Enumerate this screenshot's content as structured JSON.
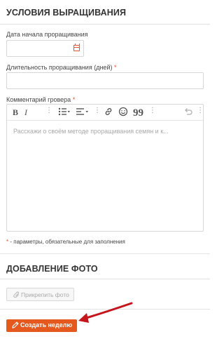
{
  "growing_conditions": {
    "title": "УСЛОВИЯ ВЫРАЩИВАНИЯ",
    "start_date_label": "Дата начала проращивания",
    "start_date_value": "",
    "duration_label": "Длительность проращивания (дней)",
    "duration_value": "",
    "required_mark": "*",
    "comment_label": "Комментарий гровера",
    "comment_placeholder": "Расскажи о своём методе проращивания семян и к...",
    "toolbar": {
      "bold": "B",
      "italic": "I",
      "link_icon": "link-icon",
      "emoji_icon": "emoji-icon",
      "quote": "99",
      "undo_icon": "undo-icon"
    },
    "required_note": "- параметры, обязательные для заполнения"
  },
  "photo_section": {
    "title": "ДОБАВЛЕНИЕ ФОТО",
    "attach_label": "Прикрепить фото"
  },
  "create_button_label": "Создать неделю",
  "colors": {
    "accent": "#e5591e",
    "required": "#e4522a",
    "arrow": "#c4161c"
  }
}
